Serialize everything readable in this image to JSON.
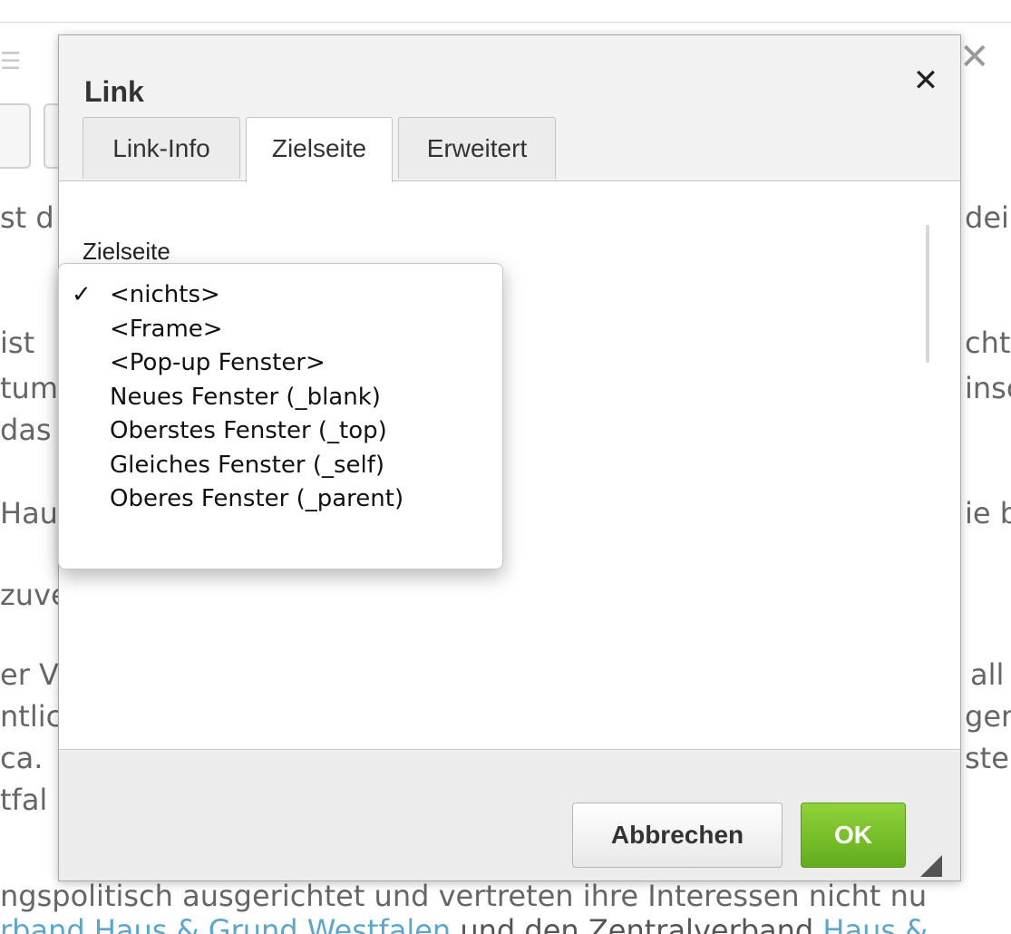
{
  "background": {
    "toolbar_icon": "☰",
    "close_glyph": "✕",
    "left_fragments": [
      "st d",
      "ist ",
      "tum",
      "das",
      "Hau",
      "zuve",
      "er V",
      "ntlic",
      "ca.",
      "tfal"
    ],
    "right_fragments": [
      "dei",
      "cht",
      "insc",
      "ie b",
      "all",
      "gen",
      "ste"
    ],
    "bottom_line": "ngspolitisch ausgerichtet und vertreten ihre Interessen nicht nu",
    "link_line": {
      "link1": "rband Haus & Grund Westfalen",
      "middle": " und den Zentralverband ",
      "link2": "Haus &"
    }
  },
  "dialog": {
    "title": "Link",
    "close_glyph": "✕",
    "tabs": [
      {
        "label": "Link-Info",
        "active": false
      },
      {
        "label": "Zielseite",
        "active": true
      },
      {
        "label": "Erweitert",
        "active": false
      }
    ],
    "field_label": "Zielseite",
    "select": {
      "selected": "<nichts>",
      "options": [
        "<nichts>",
        "<Frame>",
        "<Pop-up Fenster>",
        "Neues Fenster (_blank)",
        "Oberstes Fenster (_top)",
        "Gleiches Fenster (_self)",
        "Oberes Fenster (_parent)"
      ],
      "check_glyph": "✓"
    },
    "buttons": {
      "cancel": "Abbrechen",
      "ok": "OK"
    }
  }
}
